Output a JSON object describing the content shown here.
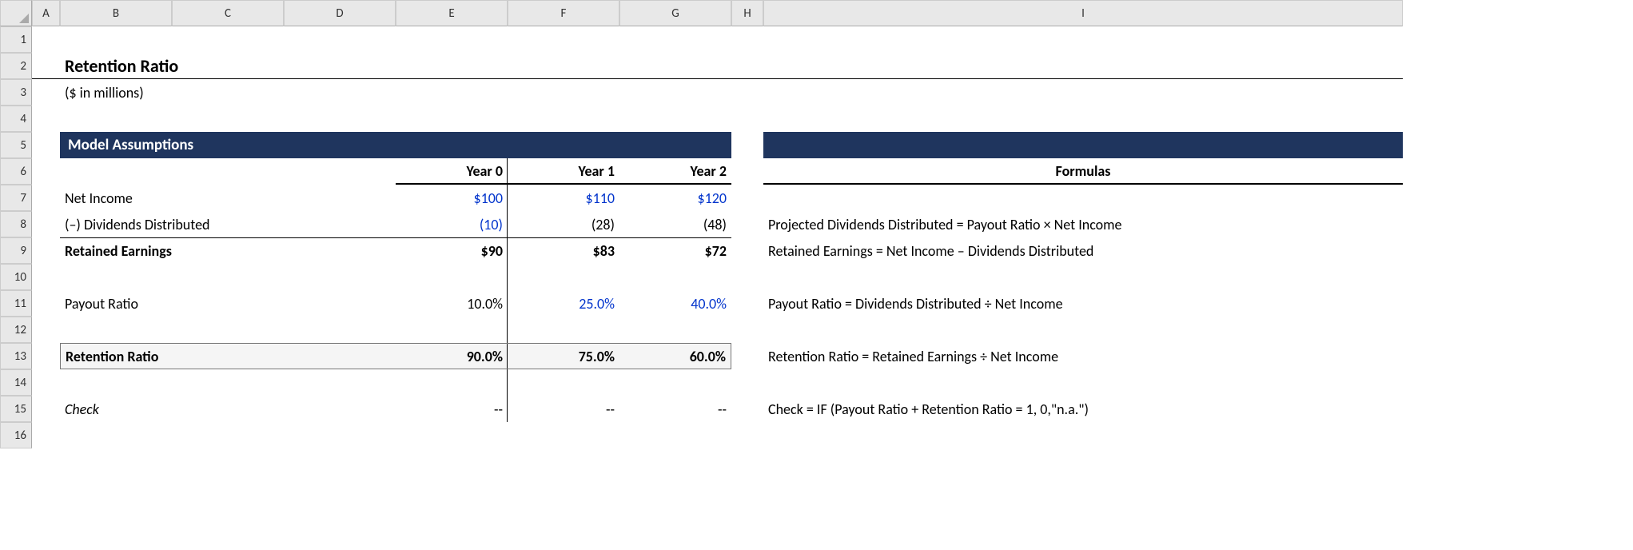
{
  "columns": [
    "A",
    "B",
    "C",
    "D",
    "E",
    "F",
    "G",
    "H",
    "I"
  ],
  "rows": [
    "1",
    "2",
    "3",
    "4",
    "5",
    "6",
    "7",
    "8",
    "9",
    "10",
    "11",
    "12",
    "13",
    "14",
    "15",
    "16"
  ],
  "title": "Retention Ratio",
  "subtitle": "($ in millions)",
  "section_header": "Model Assumptions",
  "formulas_header": "Formulas",
  "year_headers": [
    "Year 0",
    "Year 1",
    "Year 2"
  ],
  "labels": {
    "net_income": "Net Income",
    "dividends": "(–) Dividends Distributed",
    "retained": "Retained Earnings",
    "payout": "Payout Ratio",
    "retention": "Retention Ratio",
    "check": "Check"
  },
  "values": {
    "net_income": [
      "$100",
      "$110",
      "$120"
    ],
    "dividends": [
      "(10)",
      "(28)",
      "(48)"
    ],
    "retained": [
      "$90",
      "$83",
      "$72"
    ],
    "payout": [
      "10.0%",
      "25.0%",
      "40.0%"
    ],
    "retention": [
      "90.0%",
      "75.0%",
      "60.0%"
    ],
    "check": [
      "--",
      "--",
      "--"
    ]
  },
  "formulas": {
    "dividends": "Projected Dividends Distributed = Payout Ratio × Net Income",
    "retained": "Retained Earnings = Net Income – Dividends Distributed",
    "payout": "Payout Ratio = Dividends Distributed ÷ Net Income",
    "retention": "Retention Ratio = Retained Earnings ÷ Net Income",
    "check": "Check = IF (Payout Ratio + Retention Ratio = 1, 0,\"n.a.\")"
  }
}
